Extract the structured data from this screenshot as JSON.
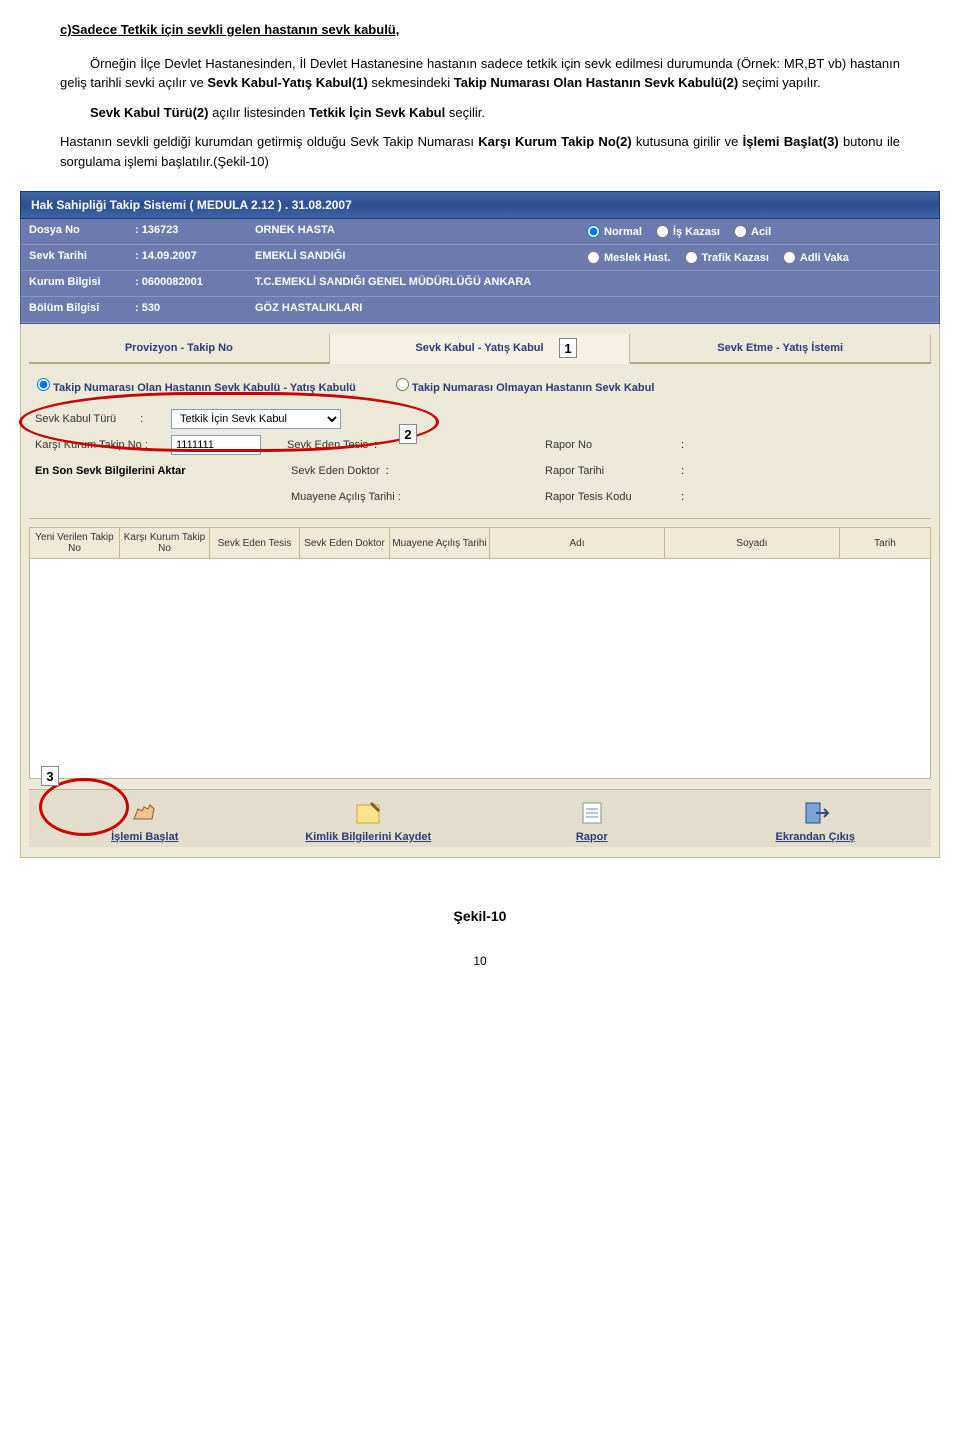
{
  "doc": {
    "heading": "c)Sadece Tetkik için sevkli gelen hastanın sevk kabulü,",
    "para1_pre": "Örneğin İlçe Devlet Hastanesinden, İl Devlet Hastanesine hastanın sadece tetkik için sevk edilmesi durumunda (Örnek: MR,BT vb) hastanın geliş tarihli sevki açılır ve ",
    "para1_b1": "Sevk Kabul-Yatış Kabul(1)",
    "para1_mid1": " sekmesindeki ",
    "para1_b2": "Takip Numarası Olan Hastanın Sevk Kabulü(2)",
    "para1_mid2": " seçimi yapılır.",
    "para2_pre": "Sevk Kabul Türü(2)",
    "para2_mid": " açılır listesinden ",
    "para2_b": "Tetkik İçin Sevk Kabul",
    "para2_end": " seçilir.",
    "para3_pre": "Hastanın sevkli geldiği kurumdan getirmiş olduğu Sevk Takip Numarası ",
    "para3_b1": "Karşı Kurum Takip No(2)",
    "para3_mid": " kutusuna girilir ve ",
    "para3_b2": "İşlemi Başlat(3)",
    "para3_end": " butonu ile sorgulama işlemi başlatılır.(Şekil-10)"
  },
  "app": {
    "title": "Hak Sahipliği Takip Sistemi  ( MEDULA 2.12 ) .  31.08.2007",
    "info": {
      "dosya_no_label": "Dosya No",
      "dosya_no_val": ": 136723",
      "dosya_no_desc": "ORNEK HASTA",
      "sevk_tarihi_label": "Sevk Tarihi",
      "sevk_tarihi_val": ": 14.09.2007",
      "sevk_tarihi_desc": "EMEKLİ SANDIĞI",
      "kurum_label": "Kurum Bilgisi",
      "kurum_val": ": 0600082001",
      "kurum_desc": "T.C.EMEKLİ SANDIĞI GENEL MÜDÜRLÜĞÜ ANKARA",
      "bolum_label": "Bölüm Bilgisi",
      "bolum_val": ": 530",
      "bolum_desc": "GÖZ HASTALIKLARI"
    },
    "radios": {
      "normal": "Normal",
      "meslek": "Meslek Hast.",
      "is_kazasi": "İş Kazası",
      "trafik": "Trafik Kazası",
      "acil": "Acil",
      "adli": "Adli Vaka"
    },
    "tabs": {
      "t1": "Provizyon - Takip No",
      "t2": "Sevk Kabul - Yatış Kabul",
      "t3": "Sevk Etme - Yatış İstemi"
    },
    "subradio": {
      "r1": "Takip Numarası Olan Hastanın Sevk Kabulü - Yatış Kabulü",
      "r2": "Takip Numarası Olmayan Hastanın Sevk Kabul"
    },
    "form": {
      "sevk_kabul_turu_label": "Sevk Kabul Türü",
      "sevk_kabul_turu_val": "Tetkik İçin Sevk Kabul",
      "karsi_kurum_label": "Karşı Kurum Takip No :",
      "karsi_kurum_val": "1111111",
      "sevk_eden_tesis": "Sevk Eden Tesis",
      "sevk_eden_doktor": "Sevk Eden Doktor",
      "muayene_acilis": "Muayene Açılış Tarihi :",
      "son_sevk_aktar": "En Son Sevk Bilgilerini Aktar",
      "rapor_no": "Rapor No",
      "rapor_tarihi": "Rapor Tarihi",
      "rapor_tesis": "Rapor Tesis Kodu"
    },
    "table_cols": {
      "c1": "Yeni Verilen Takip No",
      "c2": "Karşı Kurum Takip No",
      "c3": "Sevk Eden Tesis",
      "c4": "Sevk Eden Doktor",
      "c5": "Muayene Açılış Tarihi",
      "c6": "Adı",
      "c7": "Soyadı",
      "c8": "Tarih"
    },
    "toolbar": {
      "islemi_baslat": "İşlemi Başlat",
      "kimlik_kaydet": "Kimlik Bilgilerini Kaydet",
      "rapor": "Rapor",
      "cikis": "Ekrandan Çıkış"
    }
  },
  "badges": {
    "n1": "1",
    "n2": "2",
    "n3": "3"
  },
  "caption": "Şekil-10",
  "page": "10"
}
